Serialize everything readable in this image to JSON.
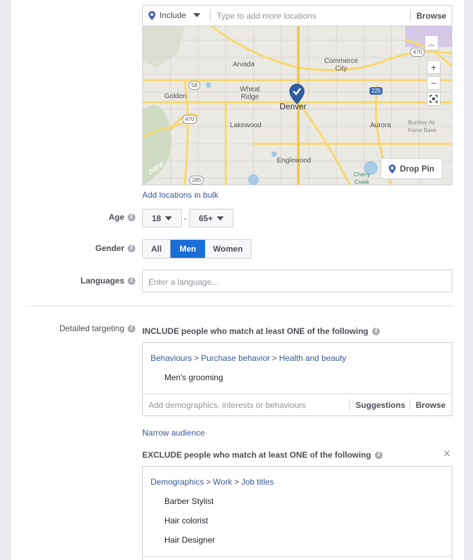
{
  "location": {
    "include_label": "Include",
    "placeholder": "Type to add more locations",
    "browse_label": "Browse",
    "add_bulk_link": "Add locations in bulk"
  },
  "map": {
    "cities": [
      "Arvada",
      "Commerce City",
      "Wheat Ridge",
      "Golden",
      "Denver",
      "Lakewood",
      "Aurora",
      "Englewood",
      "Buckley Air Force Base",
      "Cherry Creek State Park"
    ],
    "highways": [
      "58",
      "470",
      "225",
      "470",
      "285"
    ],
    "drop_pin_label": "Drop Pin",
    "zoom_in": "+",
    "zoom_out": "−",
    "brand": "here"
  },
  "age": {
    "label": "Age",
    "min": "18",
    "dash": "-",
    "max": "65+"
  },
  "gender": {
    "label": "Gender",
    "options": [
      "All",
      "Men",
      "Women"
    ],
    "selected": "Men"
  },
  "languages": {
    "label": "Languages",
    "placeholder": "Enter a language..."
  },
  "detailed": {
    "label": "Detailed targeting",
    "include_heading": "INCLUDE people who match at least ONE of the following",
    "include_crumbs": [
      "Behaviours",
      "Purchase behavior",
      "Health and beauty"
    ],
    "include_items": [
      "Men's grooming"
    ],
    "input_placeholder": "Add demographics, interests or behaviours",
    "suggestions_label": "Suggestions",
    "browse_label": "Browse",
    "narrow_link": "Narrow audience",
    "exclude_heading": "EXCLUDE people who match at least ONE of the following",
    "exclude_crumbs": [
      "Demographics",
      "Work",
      "Job titles"
    ],
    "exclude_items": [
      "Barber Stylist",
      "Hair colorist",
      "Hair Designer"
    ],
    "close_glyph": "×"
  },
  "colors": {
    "accent": "#4267b2",
    "selected_bg": "#1a6ed8",
    "link": "#365899",
    "road": "#f8d86a",
    "water": "#a6cbe3"
  }
}
